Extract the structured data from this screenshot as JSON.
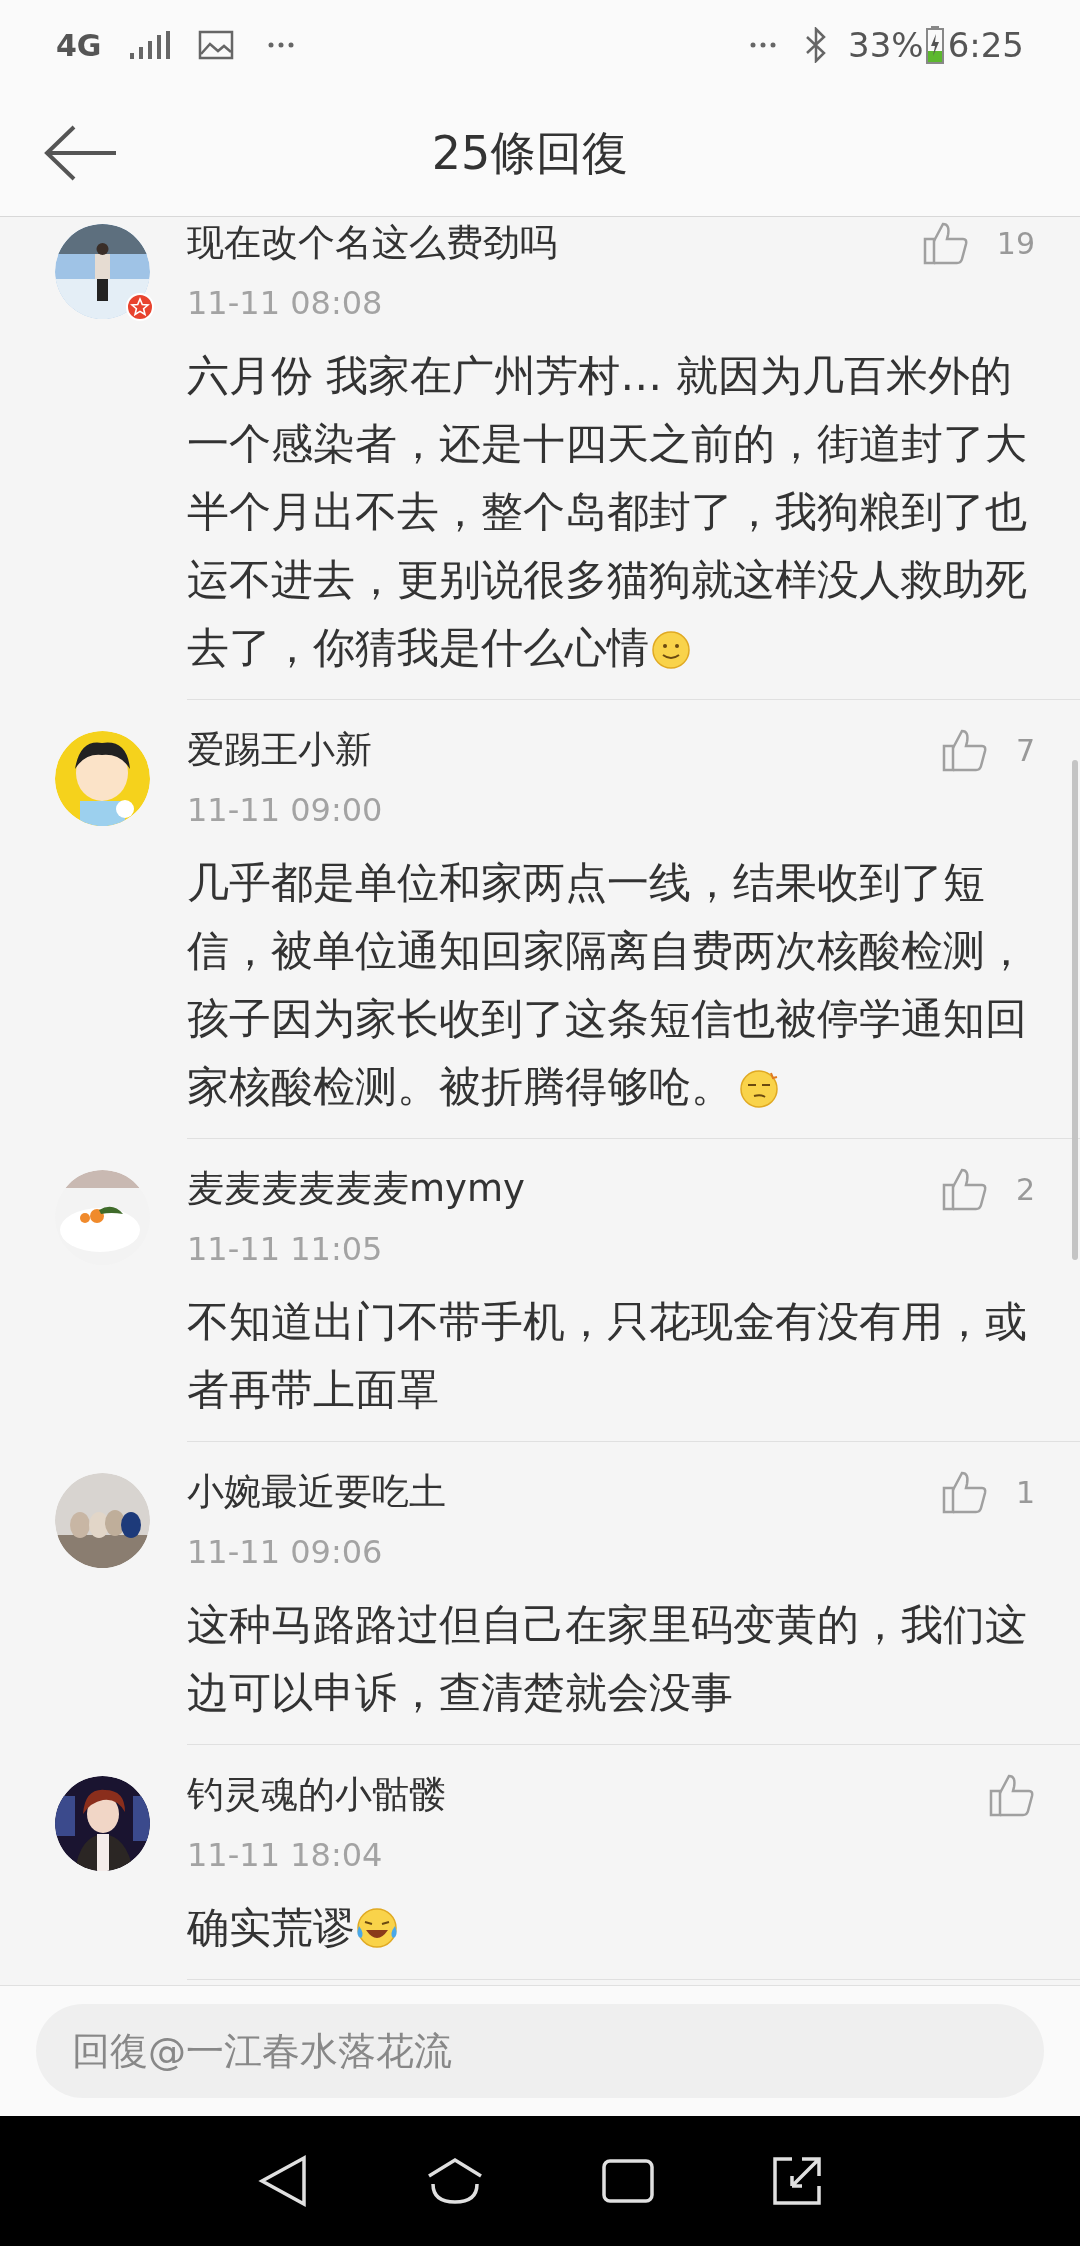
{
  "status_bar": {
    "network": "4G",
    "battery": "33%",
    "time": "6:25"
  },
  "header": {
    "title": "25條回復"
  },
  "comments": [
    {
      "name": "现在改个名这么费劲吗",
      "likes": "19",
      "time": "11-11 08:08",
      "text": "六月份 我家在广州芳村… 就因为几百米外的一个感染者，还是十四天之前的，街道封了大半个月出不去，整个岛都封了，我狗粮到了也运不进去，更别说很多猫狗就这样没人救助死去了，你猜我是什么心情",
      "emoji": {
        "kind": "smile"
      },
      "verified": true
    },
    {
      "name": "爱踢王小新",
      "likes": "7",
      "time": "11-11 09:00",
      "text": "几乎都是单位和家两点一线，结果收到了短信，被单位通知回家隔离自费两次核酸检测，孩子因为家长收到了这条短信也被停学通知回家核酸检测。被折腾得够呛。",
      "emoji": {
        "kind": "smirk"
      },
      "verified": false
    },
    {
      "name": "麦麦麦麦麦麦mymy",
      "likes": "2",
      "time": "11-11 11:05",
      "text": "不知道出门不带手机，只花现金有没有用，或者再带上面罩",
      "verified": false
    },
    {
      "name": "小婉最近要吃土",
      "likes": "1",
      "time": "11-11 09:06",
      "text": "这种马路路过但自己在家里码变黄的，我们这边可以申诉，查清楚就会没事",
      "verified": false
    },
    {
      "name": "钓灵魂的小骷髅",
      "time": "11-11 18:04",
      "text": "确实荒谬",
      "emoji": {
        "kind": "laugh-cry"
      },
      "verified": false
    }
  ],
  "reply_field": {
    "placeholder": "回復@一江春水落花流"
  }
}
